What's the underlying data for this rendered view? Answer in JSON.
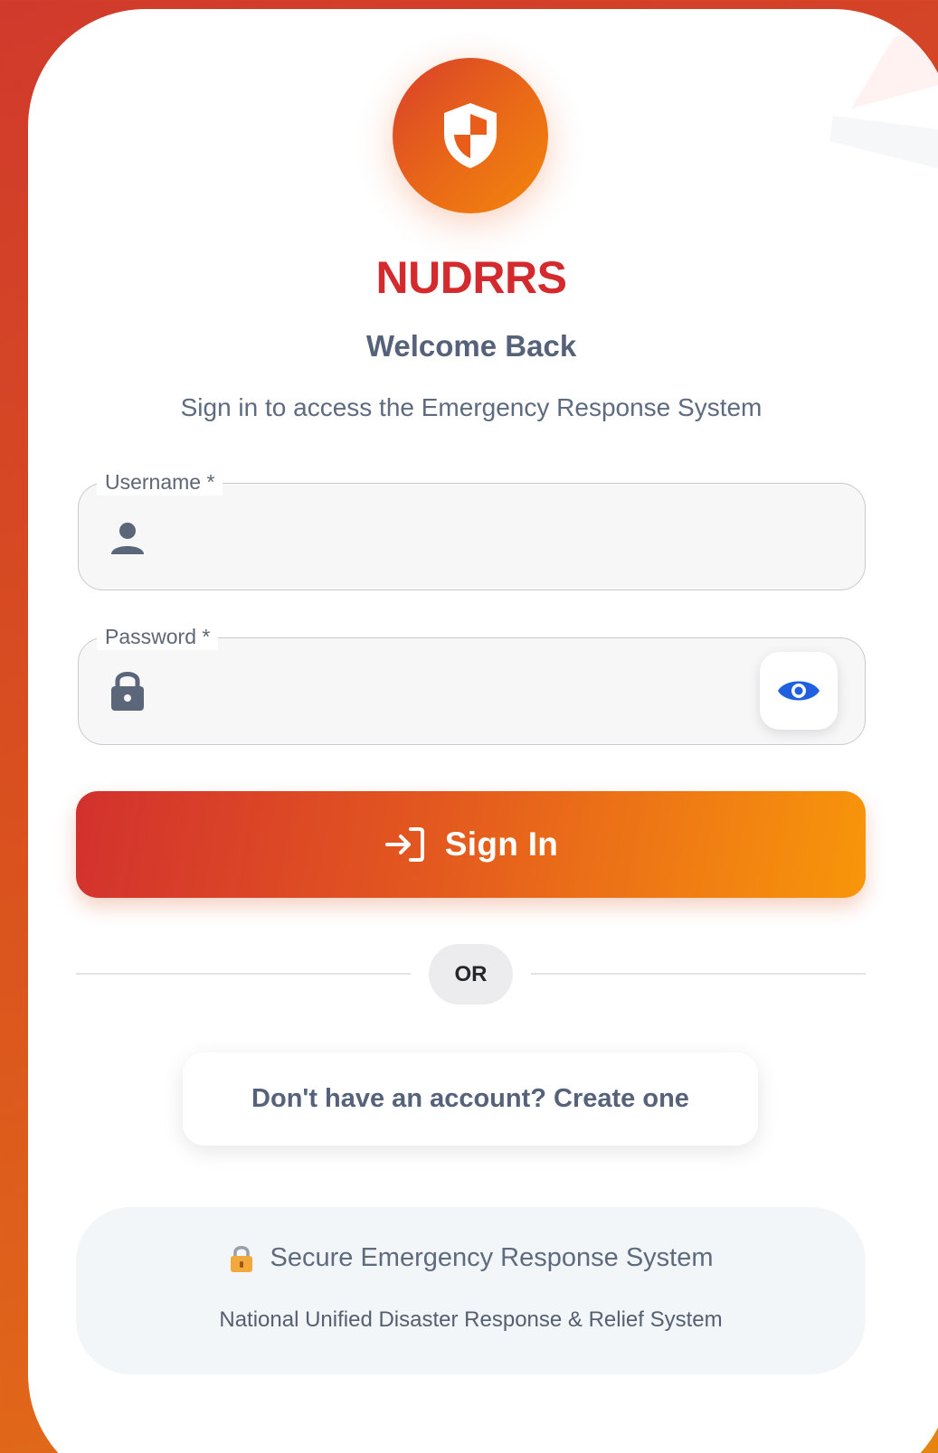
{
  "app": {
    "title": "NUDRRS",
    "welcome": "Welcome Back",
    "subtitle": "Sign in to access the Emergency Response System",
    "logo_icon": "shield-icon"
  },
  "form": {
    "username": {
      "label": "Username *",
      "value": "",
      "icon": "user-icon"
    },
    "password": {
      "label": "Password *",
      "value": "",
      "icon": "lock-icon",
      "toggle_icon": "eye-icon"
    },
    "signin_label": "Sign In",
    "signin_icon": "login-arrow-icon"
  },
  "divider": {
    "label": "OR"
  },
  "create_account": {
    "label": "Don't have an account? Create one"
  },
  "footer": {
    "secure_icon": "padlock-emoji-icon",
    "secure_text": "Secure Emergency Response System",
    "full_name": "National Unified Disaster Response & Relief System"
  },
  "colors": {
    "brand_red": "#d32a2e",
    "brand_orange": "#f8960a",
    "text_slate": "#55627a",
    "eye_blue": "#1f5fe0"
  }
}
